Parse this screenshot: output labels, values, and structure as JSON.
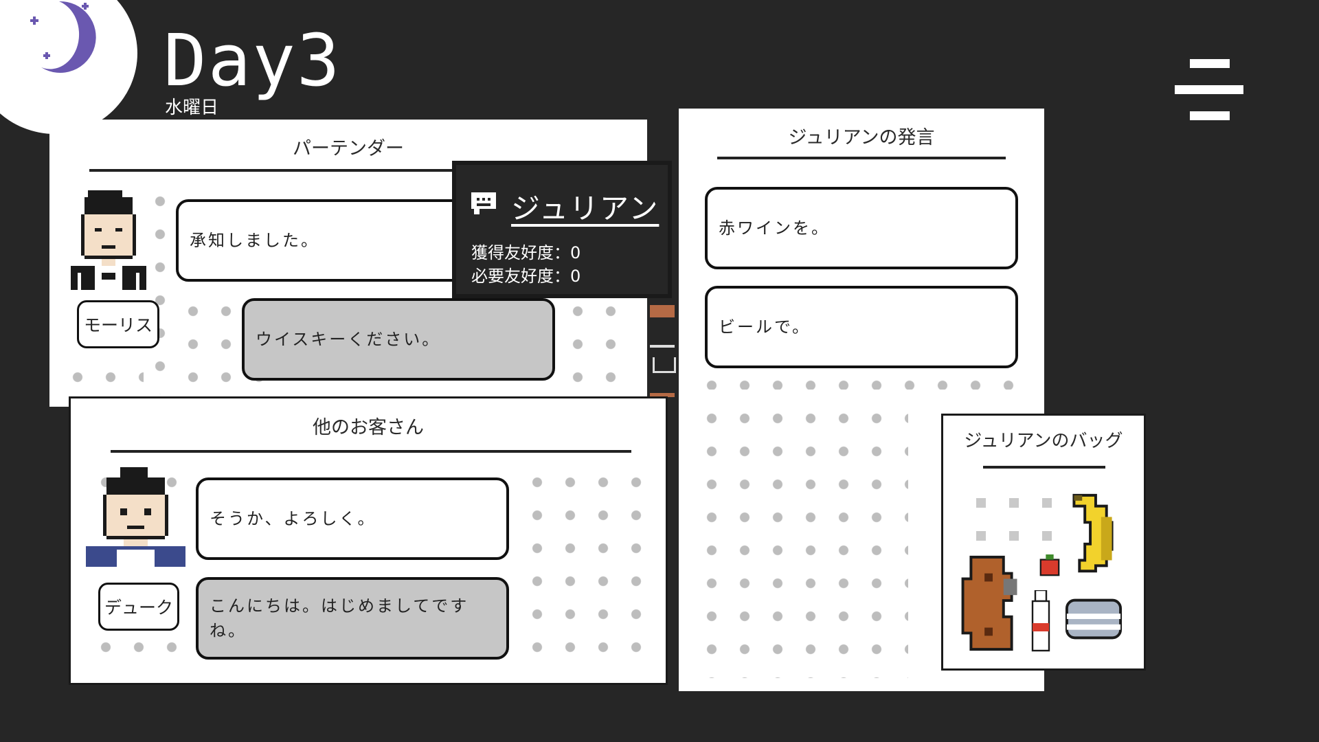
{
  "hud": {
    "day": "Day3",
    "weekday": "水曜日",
    "time_icon": "crescent-moon-icon",
    "menu_icon": "hamburger-menu-icon"
  },
  "bartender_panel": {
    "title": "パーテンダー",
    "name": "モーリス",
    "bartender_line": "承知しました。",
    "customer_line": "ウイスキーください。"
  },
  "tooltip": {
    "icon": "speech-bubble-icon",
    "name": "ジュリアン",
    "affinity_gained_label": "獲得友好度：0",
    "affinity_required_label": "必要友好度：0"
  },
  "others_panel": {
    "title": "他のお客さん",
    "name": "デューク",
    "reply": "そうか、よろしく。",
    "greeting": "こんにちは。はじめましてですね。"
  },
  "remarks_panel": {
    "title": "ジュリアンの発言",
    "options": [
      "赤ワインを。",
      "ビールで。"
    ]
  },
  "bag_panel": {
    "title": "ジュリアンのバッグ",
    "items": [
      "banana-icon",
      "tomato-icon",
      "guitar-case-icon",
      "bottle-icon",
      "tin-can-icon"
    ]
  },
  "colors": {
    "background": "#262626",
    "panel": "#ffffff",
    "dot": "#bdbdbd",
    "player_bubble": "#c6c6c6",
    "moon": "#6a58b0"
  }
}
